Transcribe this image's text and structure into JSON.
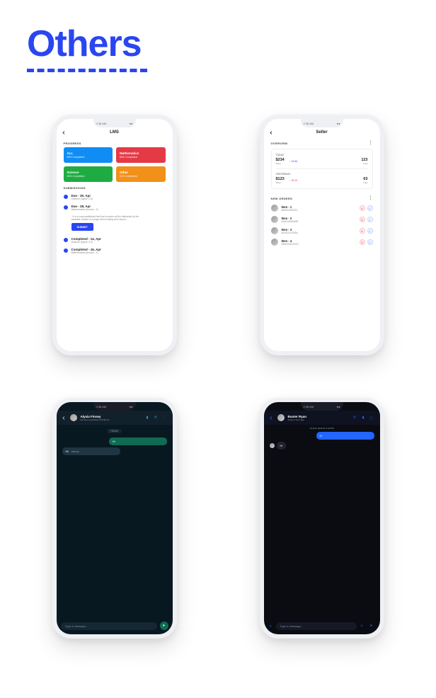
{
  "title": "Others",
  "status_time": "2:36 AM",
  "lms": {
    "header": "LMS",
    "sec_progress": "PROGRESS",
    "cards": [
      {
        "name": "ALL",
        "sub": "58% Completed",
        "color": "#0f8df5"
      },
      {
        "name": "Mathematics",
        "sub": "65% Completed",
        "color": "#e63946"
      },
      {
        "name": "Science",
        "sub": "68% Completed",
        "color": "#1fab44"
      },
      {
        "name": "Other",
        "sub": "51% Completed",
        "color": "#f29019"
      }
    ],
    "sec_submissions": "SUBMISSIONS",
    "subs": [
      {
        "t": "Due - 30, Apr",
        "s": "Science (figure 2.3)"
      },
      {
        "t": "Due - 28, Apr",
        "s": "Mathematics (lesson - 2)"
      }
    ],
    "note": "- It is a long established fact that a reader will be distracted by the readable content of a page when looking at its layout...",
    "submit": "SUBMIT",
    "done": [
      {
        "t": "Completed - 14, Apr",
        "s": "Science (figure 2.2)"
      },
      {
        "t": "Completed - 16, Apr",
        "s": "Mathematics (lesson - 1)"
      }
    ]
  },
  "seller": {
    "header": "Seller",
    "sec_overview": "OVERVIEW",
    "today": {
      "lab": "TODAY",
      "sales_v": "$234",
      "sales_l": "Sales",
      "delta": "↑ 14.54",
      "units_v": "123",
      "units_l": "Units"
    },
    "yesterday": {
      "lab": "YESTERDAY",
      "sales_v": "$123",
      "sales_l": "Sales",
      "delta": "↓ 25.29",
      "units_v": "63",
      "units_l": "Units"
    },
    "sec_orders": "NEW ORDERS",
    "orders": [
      {
        "n": "Item - 1",
        "id": "#5SD234S2SF2"
      },
      {
        "n": "Item - 2",
        "id": "#4AS1A3S6ASB"
      },
      {
        "n": "Item - 3",
        "id": "#31D221XZX6A"
      },
      {
        "n": "Item - 4",
        "id": "#9SD1DSCS22X"
      }
    ]
  },
  "wa": {
    "name": "Alysia Finney",
    "status": "last seen yesterday at 9:09 pm",
    "day": "TODAY",
    "msg_in": "Hii",
    "msg_out": "Hii",
    "time": "8:40 pm",
    "placeholder": "Type a message..."
  },
  "msn": {
    "name": "Buster Ryan",
    "status": "Active 4 hour ago",
    "timestamp": "16 AUG 2020 AT 9:44 PM",
    "msg_in": "Hi",
    "msg_out": "Hi",
    "placeholder": "Type a message..."
  }
}
